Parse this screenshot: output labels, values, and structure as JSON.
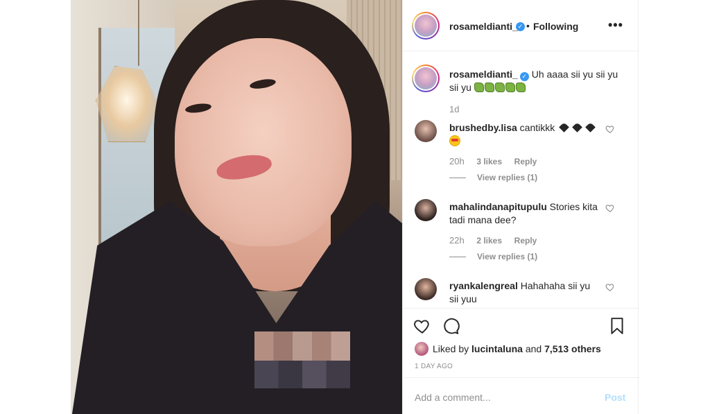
{
  "post": {
    "username": "rosameldianti_",
    "follow_separator": "•",
    "follow_status": "Following",
    "more_icon": "more-options-icon"
  },
  "caption": {
    "username": "rosameldianti_",
    "text": "Uh aaaa sii yu sii yu sii yu",
    "emoji_count": 5,
    "emoji_name": "snake-emoji",
    "time": "1d"
  },
  "comments": [
    {
      "username": "brushedby.lisa",
      "text": "cantikkk",
      "emoji_suffix": [
        "black-heart",
        "black-heart",
        "black-heart",
        "heart-eyes-face"
      ],
      "time": "20h",
      "likes": "3 likes",
      "reply_label": "Reply",
      "view_replies": "View replies (1)"
    },
    {
      "username": "mahalindanapitupulu",
      "text": "Stories kita tadi mana dee?",
      "time": "22h",
      "likes": "2 likes",
      "reply_label": "Reply",
      "view_replies": "View replies (1)"
    },
    {
      "username": "ryankalengreal",
      "text": "Hahahaha sii yu sii yuu"
    }
  ],
  "actions": {
    "liked_prefix": "Liked by",
    "liked_user": "lucintaluna",
    "liked_and": "and",
    "liked_others": "7,513 others",
    "time_ago": "1 DAY AGO"
  },
  "add_comment": {
    "placeholder": "Add a comment...",
    "post_label": "Post"
  },
  "colors": {
    "text": "#262626",
    "muted": "#8e8e8e",
    "verified": "#3897f0",
    "post_disabled": "#b2dffc",
    "border": "#efefef"
  }
}
